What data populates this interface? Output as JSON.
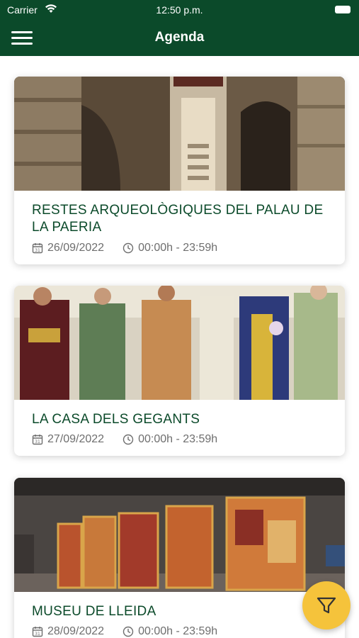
{
  "status_bar": {
    "carrier": "Carrier",
    "time": "12:50 p.m."
  },
  "nav": {
    "title": "Agenda",
    "menu_icon": "hamburger-menu-icon"
  },
  "events": [
    {
      "title": "RESTES ARQUEOLÒGIQUES DEL PALAU DE LA PAERIA",
      "date": "26/09/2022",
      "time": "00:00h - 23:59h"
    },
    {
      "title": "LA CASA DELS GEGANTS",
      "date": "27/09/2022",
      "time": "00:00h - 23:59h"
    },
    {
      "title": "MUSEU DE LLEIDA",
      "date": "28/09/2022",
      "time": "00:00h - 23:59h"
    }
  ],
  "filter_button": {
    "icon": "filter-funnel-icon",
    "color": "#f5c33b"
  },
  "colors": {
    "brand_green": "#0b4a2a",
    "meta_gray": "#6e6e6e"
  }
}
